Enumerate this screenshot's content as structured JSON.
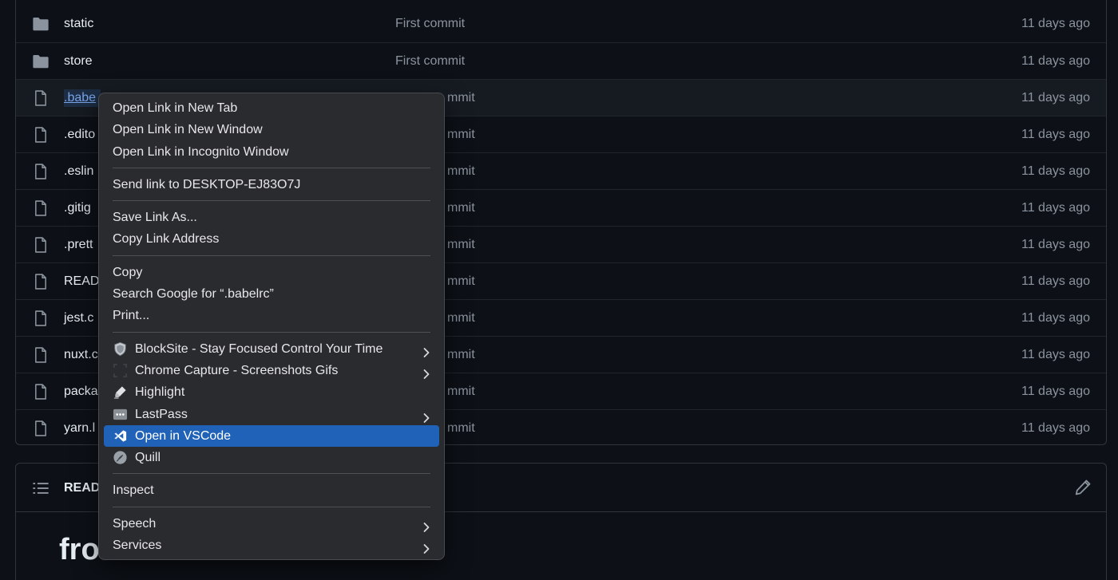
{
  "file_list": {
    "rows": [
      {
        "type": "folder",
        "name": "static",
        "message": "First commit",
        "date": "11 days ago"
      },
      {
        "type": "folder",
        "name": "store",
        "message": "First commit",
        "date": "11 days ago"
      },
      {
        "type": "file",
        "name": ".babe",
        "message": "mmit",
        "date": "11 days ago",
        "hovered": true
      },
      {
        "type": "file",
        "name": ".edito",
        "message": "mmit",
        "date": "11 days ago"
      },
      {
        "type": "file",
        "name": ".eslin",
        "message": "mmit",
        "date": "11 days ago"
      },
      {
        "type": "file",
        "name": ".gitig",
        "message": "mmit",
        "date": "11 days ago"
      },
      {
        "type": "file",
        "name": ".prett",
        "message": "mmit",
        "date": "11 days ago"
      },
      {
        "type": "file",
        "name": "READ",
        "message": "mmit",
        "date": "11 days ago"
      },
      {
        "type": "file",
        "name": "jest.c",
        "message": "mmit",
        "date": "11 days ago"
      },
      {
        "type": "file",
        "name": "nuxt.c",
        "message": "mmit",
        "date": "11 days ago"
      },
      {
        "type": "file",
        "name": "packa",
        "message": "mmit",
        "date": "11 days ago"
      },
      {
        "type": "file",
        "name": "yarn.l",
        "message": "mmit",
        "date": "11 days ago"
      }
    ]
  },
  "readme": {
    "title": "READ",
    "heading": "fro"
  },
  "context_menu": {
    "groups": [
      [
        {
          "label": "Open Link in New Tab"
        },
        {
          "label": "Open Link in New Window"
        },
        {
          "label": "Open Link in Incognito Window"
        }
      ],
      [
        {
          "label": "Send link to DESKTOP-EJ83O7J"
        }
      ],
      [
        {
          "label": "Save Link As..."
        },
        {
          "label": "Copy Link Address"
        }
      ],
      [
        {
          "label": "Copy"
        },
        {
          "label": "Search Google for “.babelrc”"
        },
        {
          "label": "Print..."
        }
      ],
      [
        {
          "label": "BlockSite - Stay Focused  Control Your Time",
          "icon": "blocksite-shield-icon",
          "submenu": true
        },
        {
          "label": "Chrome Capture - Screenshots  Gifs",
          "icon": "chrome-capture-icon",
          "submenu": true
        },
        {
          "label": "Highlight",
          "icon": "highlighter-icon"
        },
        {
          "label": "LastPass",
          "icon": "lastpass-icon",
          "submenu": true
        },
        {
          "label": "Open in VSCode",
          "icon": "vscode-icon",
          "highlighted": true
        },
        {
          "label": "Quill",
          "icon": "quill-icon"
        }
      ],
      [
        {
          "label": "Inspect"
        }
      ],
      [
        {
          "label": "Speech",
          "submenu": true
        },
        {
          "label": "Services",
          "submenu": true
        }
      ]
    ]
  },
  "colors": {
    "background": "#0d1117",
    "menu_background": "#2a2b2f",
    "menu_highlight": "#1f62b8",
    "link": "#79a5e8"
  }
}
